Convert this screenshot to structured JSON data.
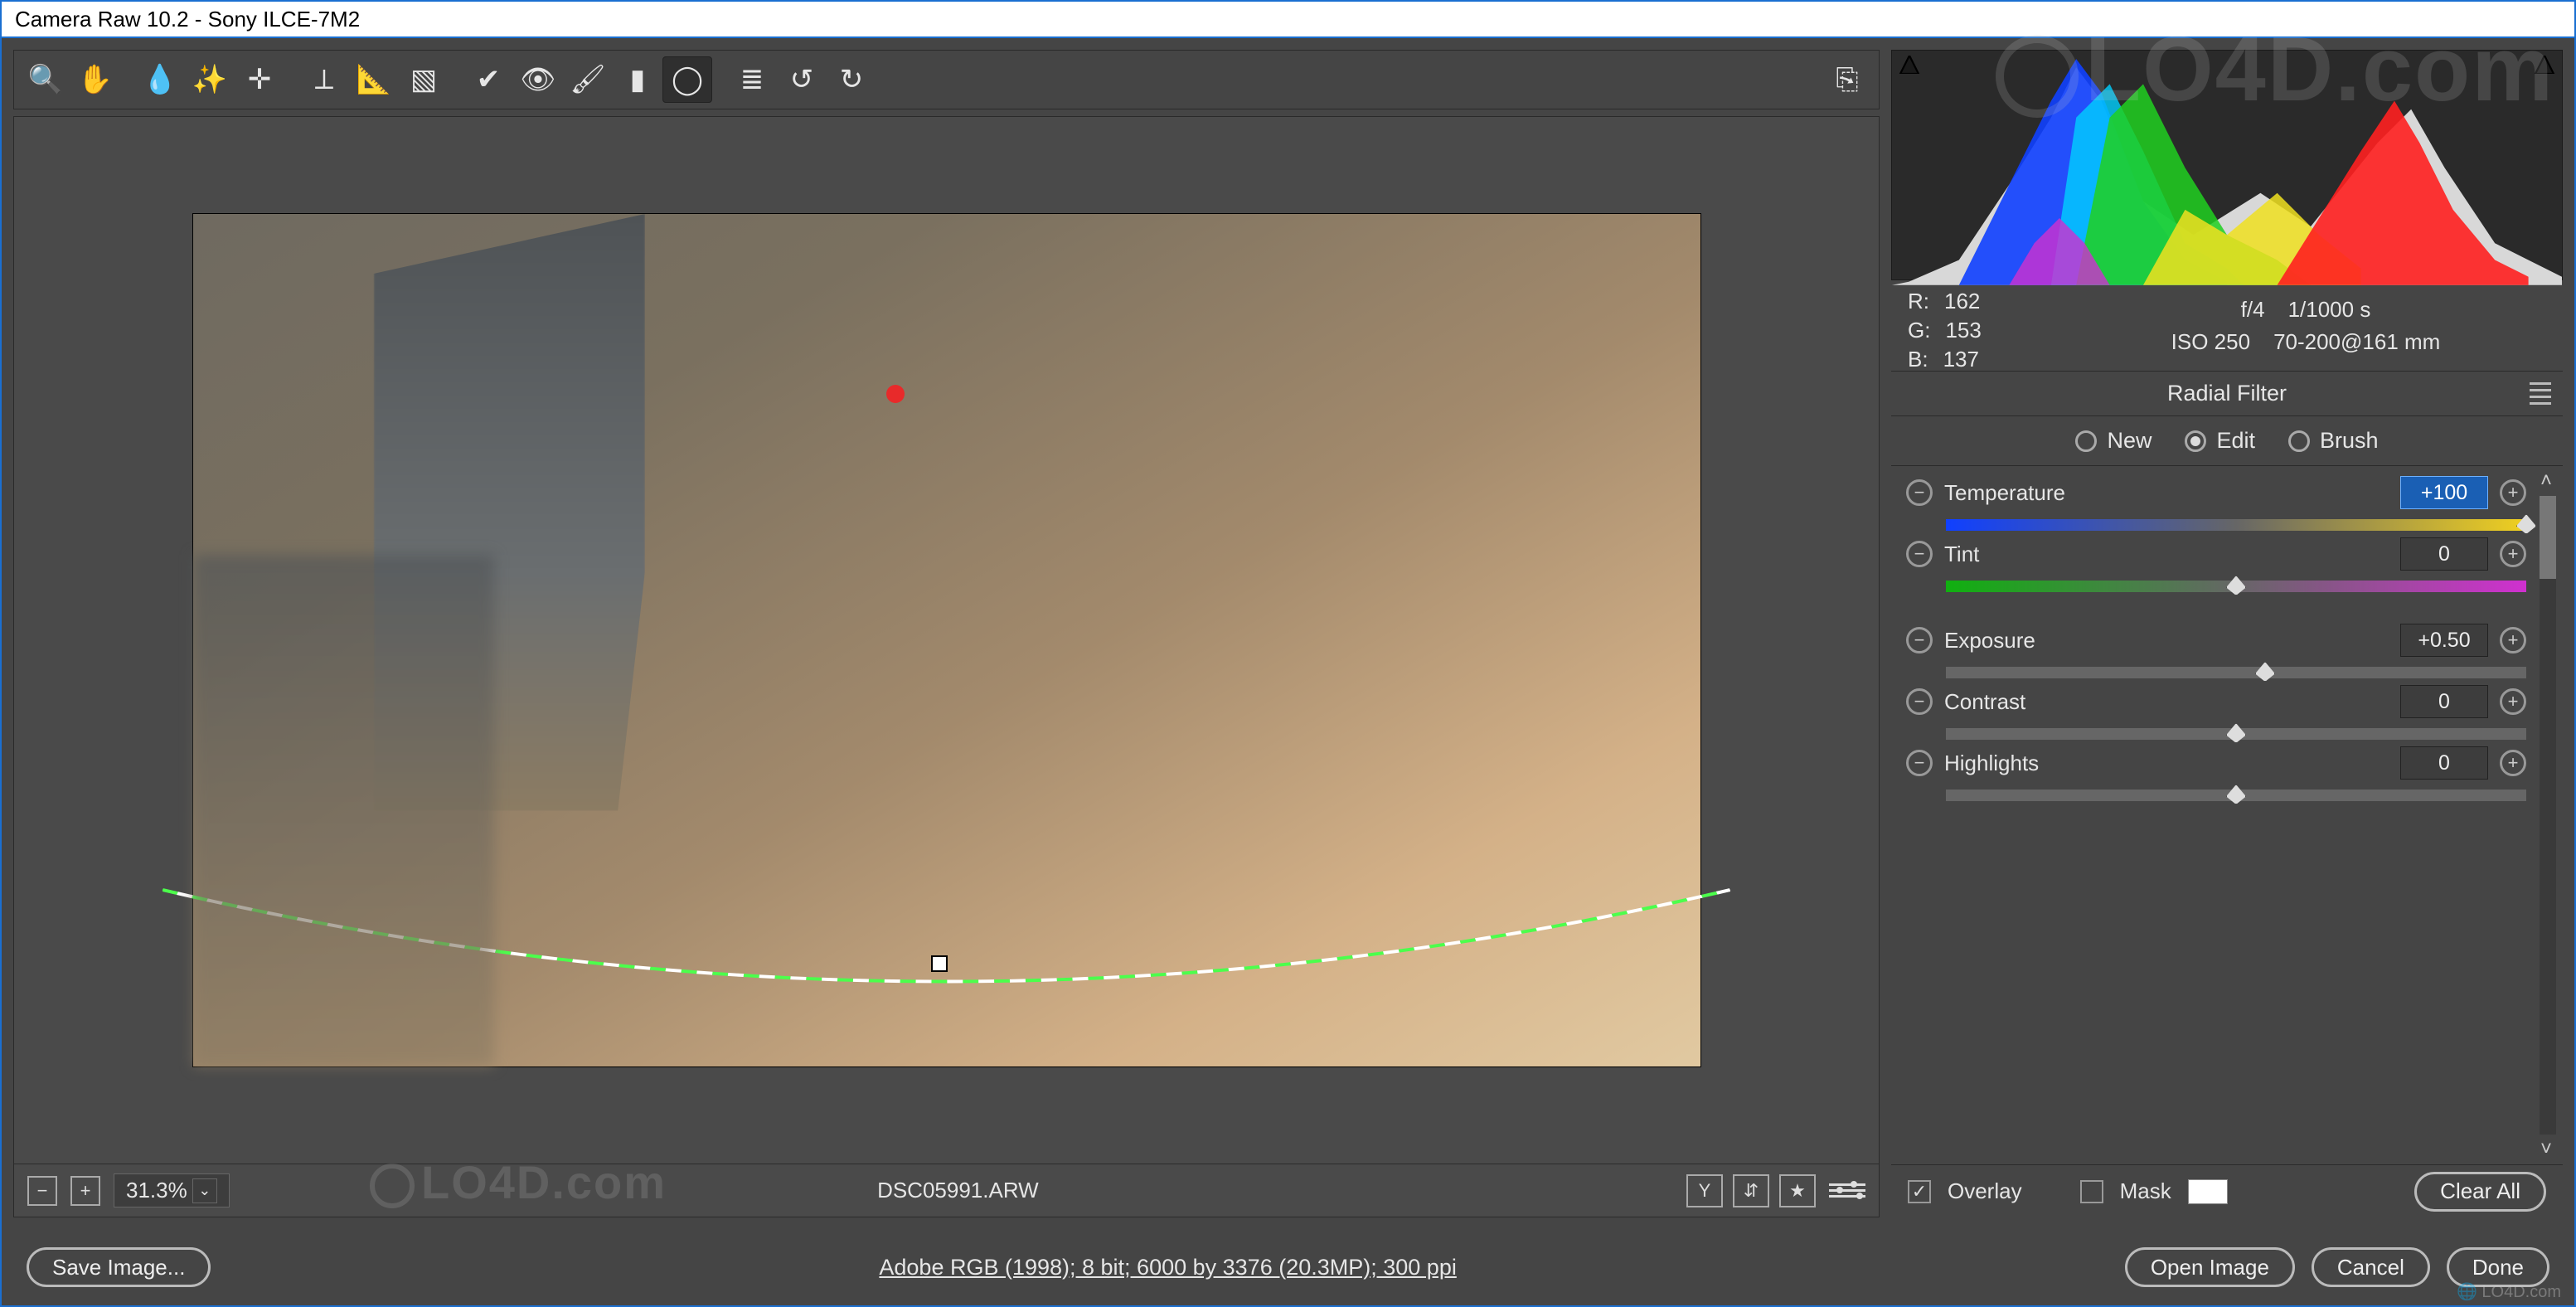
{
  "titlebar": {
    "text": "Camera Raw 10.2  -  Sony ILCE-7M2"
  },
  "toolbar": {
    "items": [
      {
        "id": "zoom",
        "glyph": "🔍"
      },
      {
        "id": "hand",
        "glyph": "✋"
      },
      {
        "sep": true
      },
      {
        "id": "wb",
        "glyph": "💧"
      },
      {
        "id": "color-sampler",
        "glyph": "✨"
      },
      {
        "id": "target",
        "glyph": "✛"
      },
      {
        "sep": true
      },
      {
        "id": "crop",
        "glyph": "⟂"
      },
      {
        "id": "straighten",
        "glyph": "📐"
      },
      {
        "id": "transform",
        "glyph": "▧"
      },
      {
        "sep": true
      },
      {
        "id": "spot",
        "glyph": "✔"
      },
      {
        "id": "redeye",
        "glyph": "👁"
      },
      {
        "id": "adjust-brush",
        "glyph": "🖌"
      },
      {
        "id": "graduated",
        "glyph": "▮"
      },
      {
        "id": "radial",
        "glyph": "◯",
        "active": true
      },
      {
        "sep": true
      },
      {
        "id": "presets",
        "glyph": "≣"
      },
      {
        "id": "rotate-ccw",
        "glyph": "↺"
      },
      {
        "id": "rotate-cw",
        "glyph": "↻"
      }
    ],
    "export_glyph": "⎘"
  },
  "status": {
    "zoom": "31.3%",
    "filename": "DSC05991.ARW",
    "right_icons": [
      "Y",
      "⇵",
      "★"
    ]
  },
  "exif": {
    "r_label": "R:",
    "r": "162",
    "g_label": "G:",
    "g": "153",
    "b_label": "B:",
    "b": "137",
    "aperture": "f/4",
    "shutter": "1/1000 s",
    "iso": "ISO 250",
    "lens": "70-200@161 mm"
  },
  "panel": {
    "title": "Radial Filter",
    "modes": [
      {
        "id": "new",
        "label": "New",
        "checked": false
      },
      {
        "id": "edit",
        "label": "Edit",
        "checked": true
      },
      {
        "id": "brush",
        "label": "Brush",
        "checked": false
      }
    ]
  },
  "sliders": [
    {
      "id": "temperature",
      "label": "Temperature",
      "value": "+100",
      "pos": 100,
      "gradient": "temp",
      "selected": true
    },
    {
      "id": "tint",
      "label": "Tint",
      "value": "0",
      "pos": 50,
      "gradient": "tint"
    },
    {
      "spacer": true
    },
    {
      "id": "exposure",
      "label": "Exposure",
      "value": "+0.50",
      "pos": 55
    },
    {
      "id": "contrast",
      "label": "Contrast",
      "value": "0",
      "pos": 50
    },
    {
      "id": "highlights",
      "label": "Highlights",
      "value": "0",
      "pos": 50
    }
  ],
  "overlay_row": {
    "overlay_label": "Overlay",
    "overlay_checked": true,
    "mask_label": "Mask",
    "mask_checked": false,
    "clear_label": "Clear All"
  },
  "footer": {
    "save_label": "Save Image...",
    "workflow": "Adobe RGB (1998); 8 bit; 6000 by 3376 (20.3MP); 300 ppi",
    "open_label": "Open Image",
    "cancel_label": "Cancel",
    "done_label": "Done"
  },
  "watermark": "LO4D.com"
}
